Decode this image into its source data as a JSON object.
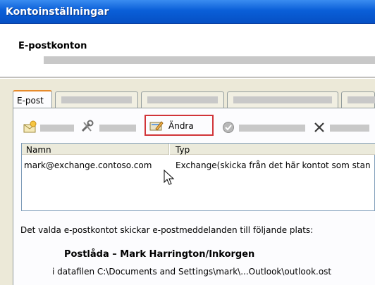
{
  "window": {
    "title": "Kontoinställningar"
  },
  "header": {
    "title": "E-postkonton"
  },
  "tabs": [
    {
      "label": "E-post"
    }
  ],
  "toolbar": {
    "change_label": "Ändra",
    "icons": [
      "new-account-icon",
      "repair-icon",
      "change-icon",
      "set-default-icon",
      "remove-icon"
    ]
  },
  "accounts": {
    "columns": [
      "Namn",
      "Typ"
    ],
    "rows": [
      {
        "name": "mark@exchange.contoso.com",
        "type": "Exchange(skicka från det här kontot som stan"
      }
    ]
  },
  "delivery": {
    "description": "Det valda e-postkontot skickar e-postmeddelanden till följande plats:",
    "mailbox": "Postlåda – Mark Harrington/Inkorgen",
    "datafile": "i datafilen C:\\Documents and Settings\\mark\\...Outlook\\outlook.ost"
  },
  "colors": {
    "titlebar": "#0a5fd8",
    "tab_accent": "#e68b2c",
    "highlight_border": "#d13438"
  }
}
